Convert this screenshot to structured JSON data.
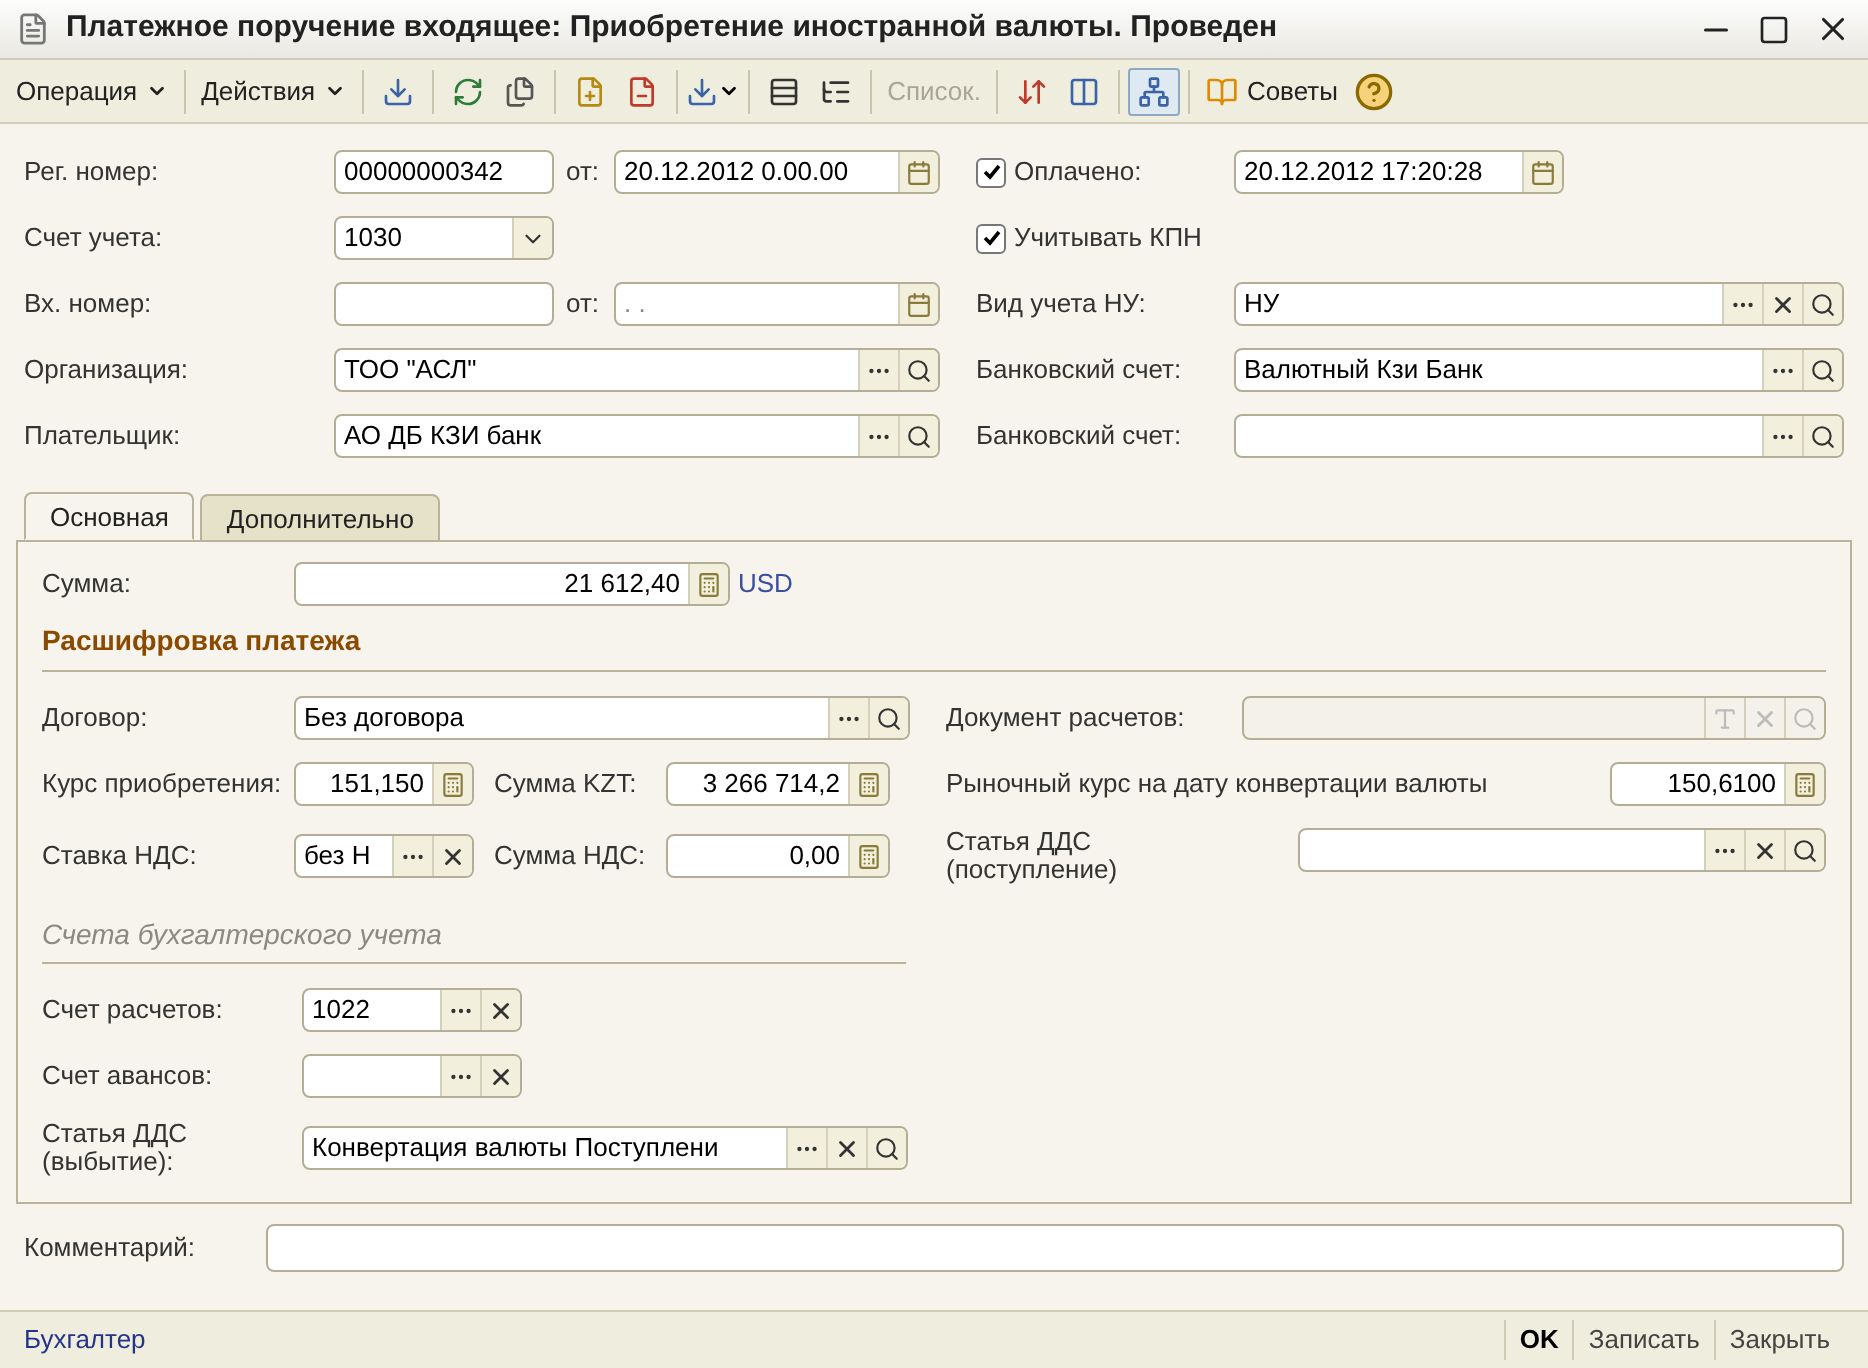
{
  "window": {
    "title": "Платежное поручение входящее: Приобретение иностранной валюты. Проведен"
  },
  "toolbar": {
    "menus": [
      "Операция",
      "Действия"
    ],
    "list_button": {
      "label": "Список.",
      "disabled": true
    },
    "tree_toggle": {
      "pressed": true
    },
    "tips_button": "Советы"
  },
  "header": {
    "reg_number": {
      "label": "Рег. номер:",
      "value": "00000000342",
      "date_label": "от:",
      "date": "20.12.2012  0.00.00"
    },
    "account": {
      "label": "Счет учета:",
      "value": "1030",
      "kind": "select"
    },
    "incoming": {
      "label": "Вх. номер:",
      "date_label": "от:",
      "date_placeholder": ". ."
    },
    "organization": {
      "label": "Организация:",
      "value": "ТОО \"АСЛ\"",
      "kind": "ref"
    },
    "payer": {
      "label": "Плательщик:",
      "value": "АО ДБ КЗИ банк",
      "kind": "ref"
    },
    "paid": {
      "label": "Оплачено:",
      "checked": true,
      "date": "20.12.2012 17:20:28"
    },
    "kpn": {
      "label": "Учитывать КПН",
      "checked": true
    },
    "right_fields": [
      {
        "label": "Вид учета НУ:",
        "value": "НУ",
        "kind": "ref_clear_search"
      },
      {
        "label": "Банковский счет:",
        "value": "Валютный Кзи Банк",
        "kind": "ref"
      },
      {
        "label": "Банковский счет:",
        "kind": "ref"
      }
    ]
  },
  "tabs": [
    {
      "label": "Основная",
      "selected": true
    },
    {
      "label": "Дополнительно",
      "selected": false
    }
  ],
  "sum": {
    "label": "Сумма:",
    "value": "21 612,40",
    "currency": "USD"
  },
  "payment": {
    "title": "Расшифровка платежа",
    "contract": {
      "label": "Договор:",
      "value": "Без договора",
      "kind": "ref"
    },
    "settlement_doc": {
      "label": "Документ расчетов:",
      "kind": "ref_t",
      "disabled": true
    },
    "rate": {
      "label": "Курс приобретения:",
      "value": "151,150",
      "kind": "calc"
    },
    "sum_kzt": {
      "label": "Сумма KZT:",
      "value": "3 266 714,2",
      "kind": "calc"
    },
    "market_rate": {
      "label": "Рыночный курс на дату конвертации валюты",
      "value": "150,6100",
      "kind": "calc"
    },
    "vat_rate": {
      "label": "Ставка НДС:",
      "value": "без Н",
      "kind": "ref_clear"
    },
    "vat_sum": {
      "label": "Сумма НДС:",
      "value": "0,00",
      "kind": "calc"
    },
    "cash_flow_in": {
      "label": "Статья ДДС (поступление)",
      "kind": "ref_clear_search"
    }
  },
  "accounts": {
    "title": "Счета бухгалтерского учета",
    "rows": [
      {
        "label": "Счет расчетов:",
        "value": "1022",
        "kind": "ref_clear"
      },
      {
        "label": "Счет авансов:",
        "kind": "ref_clear"
      },
      {
        "label": "Статья ДДС (выбытие):",
        "value": "Конвертация валюты Поступлени",
        "kind": "ref_clear_search"
      }
    ]
  },
  "comment": {
    "label": "Комментарий:"
  },
  "footer": {
    "user": "Бухгалтер",
    "buttons": [
      {
        "label": "OK",
        "default": true
      },
      {
        "label": "Записать",
        "default": false
      },
      {
        "label": "Закрыть",
        "default": false
      }
    ]
  }
}
